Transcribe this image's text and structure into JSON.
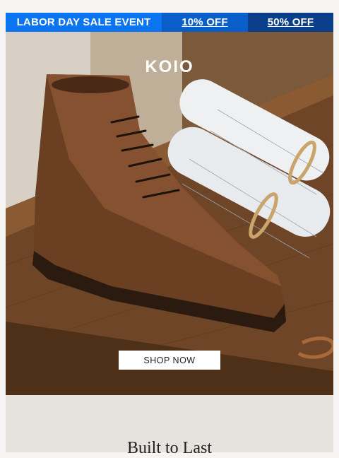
{
  "banner": {
    "event_label": "LABOR DAY SALE EVENT",
    "offer_1": "10% OFF",
    "offer_2": "50% OFF",
    "colors": [
      "#0b74f0",
      "#0a5ec9",
      "#0b3f8a"
    ]
  },
  "hero": {
    "brand": "KOIO",
    "cta_label": "SHOP NOW"
  },
  "section": {
    "heading": "Built to Last"
  }
}
